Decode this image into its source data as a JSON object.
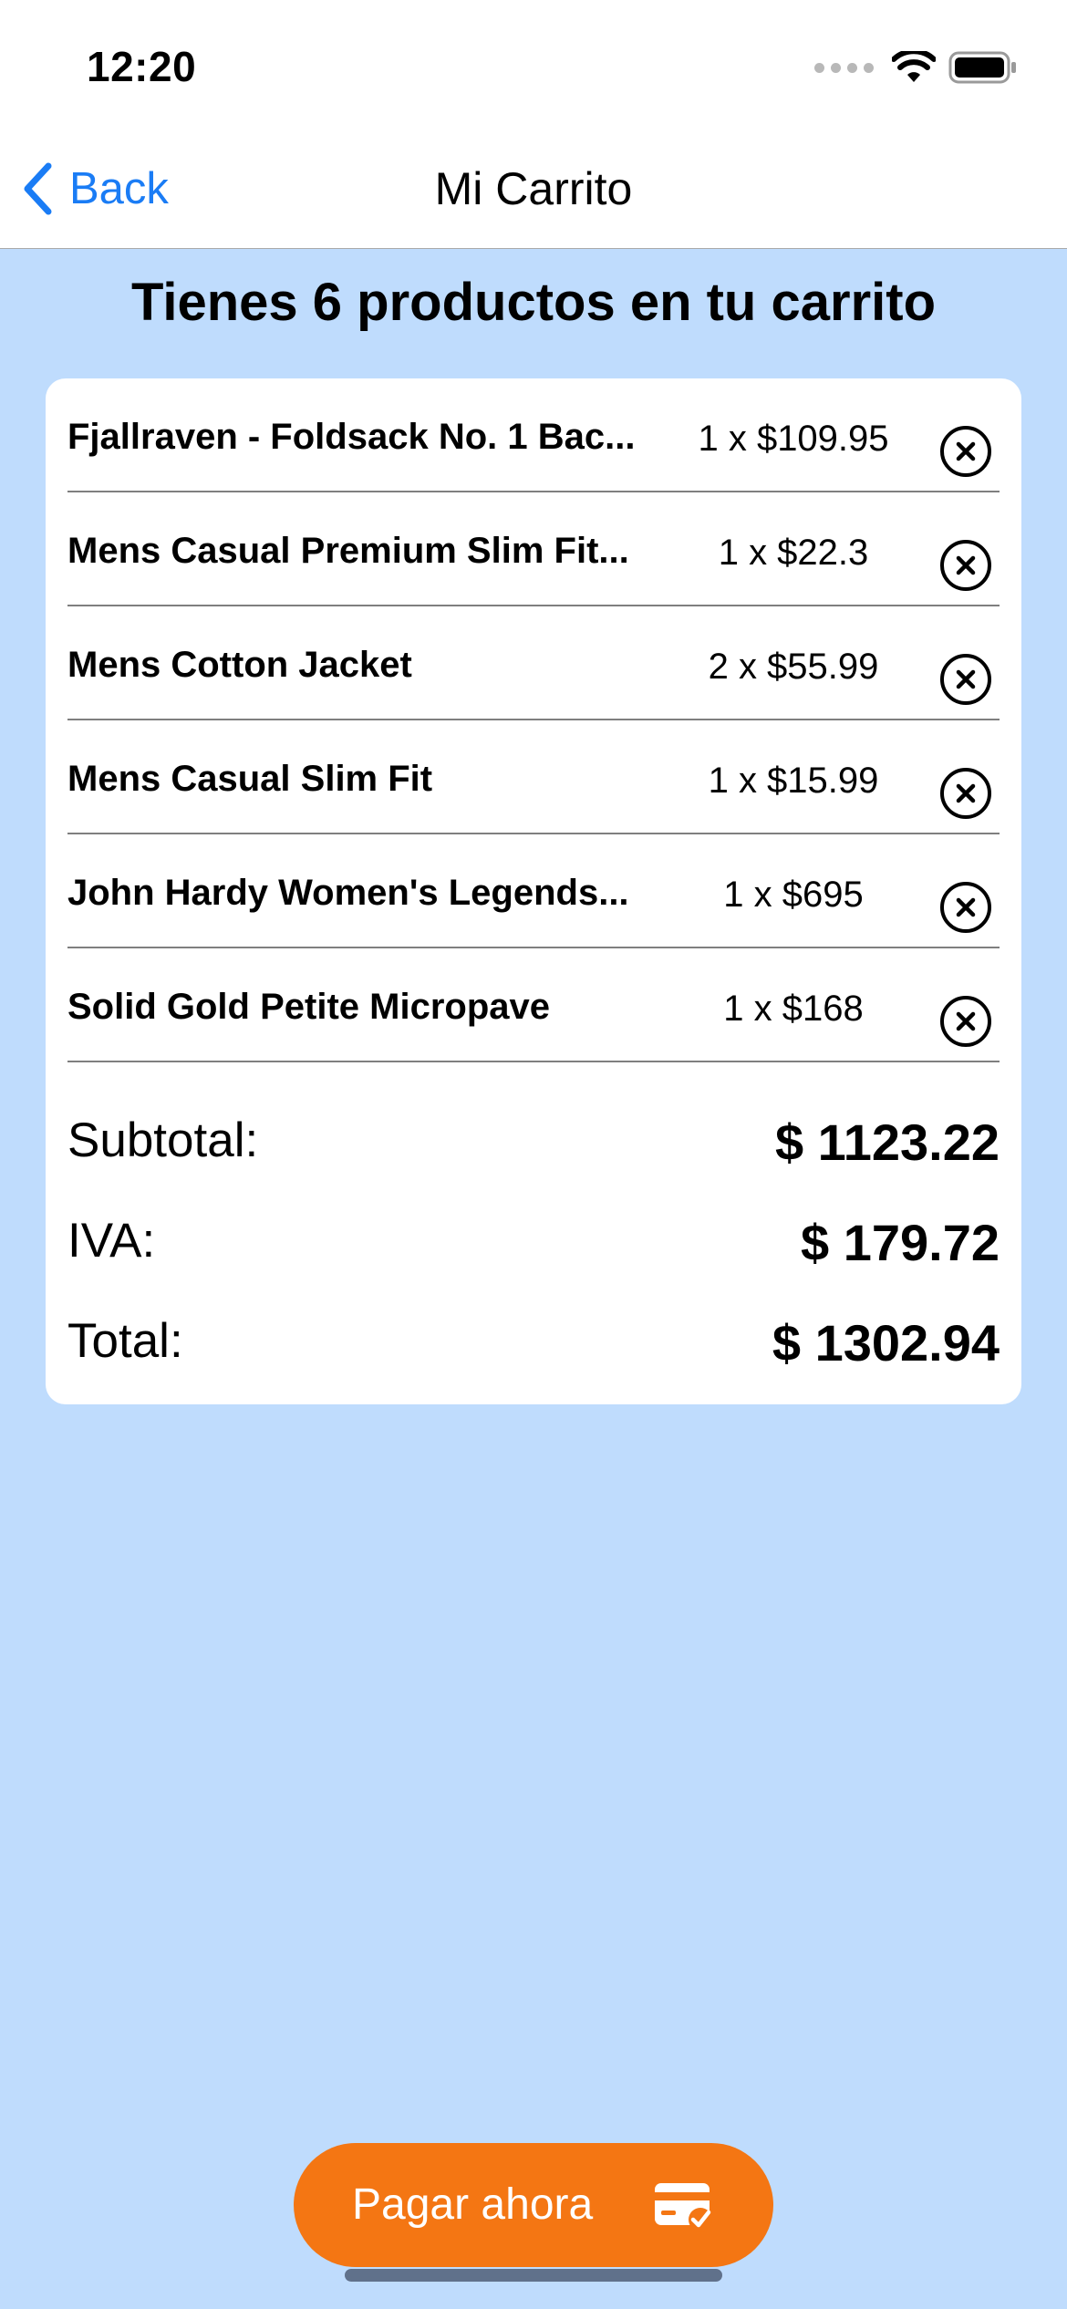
{
  "status_bar": {
    "time": "12:20"
  },
  "nav": {
    "back_label": "Back",
    "title": "Mi Carrito"
  },
  "heading": "Tienes 6 productos en tu carrito",
  "items": [
    {
      "name": "Fjallraven - Foldsack No. 1 Bac...",
      "qty": "1 x $109.95"
    },
    {
      "name": "Mens Casual Premium Slim Fit...",
      "qty": "1 x $22.3"
    },
    {
      "name": "Mens Cotton Jacket",
      "qty": "2 x $55.99"
    },
    {
      "name": "Mens Casual Slim Fit",
      "qty": "1 x $15.99"
    },
    {
      "name": "John Hardy Women's Legends...",
      "qty": "1 x $695"
    },
    {
      "name": "Solid Gold Petite Micropave",
      "qty": "1 x $168"
    }
  ],
  "summary": {
    "subtotal_label": "Subtotal:",
    "subtotal_value": "$ 1123.22",
    "iva_label": "IVA:",
    "iva_value": "$ 179.72",
    "total_label": "Total:",
    "total_value": "$ 1302.94"
  },
  "pay_button": {
    "label": "Pagar ahora",
    "icon": "credit-card-check-icon"
  },
  "icons": {
    "back": "chevron-left-icon",
    "remove": "x-circle-icon",
    "wifi": "wifi-icon",
    "battery": "battery-icon",
    "signal": "signal-dots-icon"
  },
  "colors": {
    "background": "#bfdcfd",
    "accent": "#1a7cf5",
    "pay_button": "#f47613",
    "card": "#ffffff"
  }
}
